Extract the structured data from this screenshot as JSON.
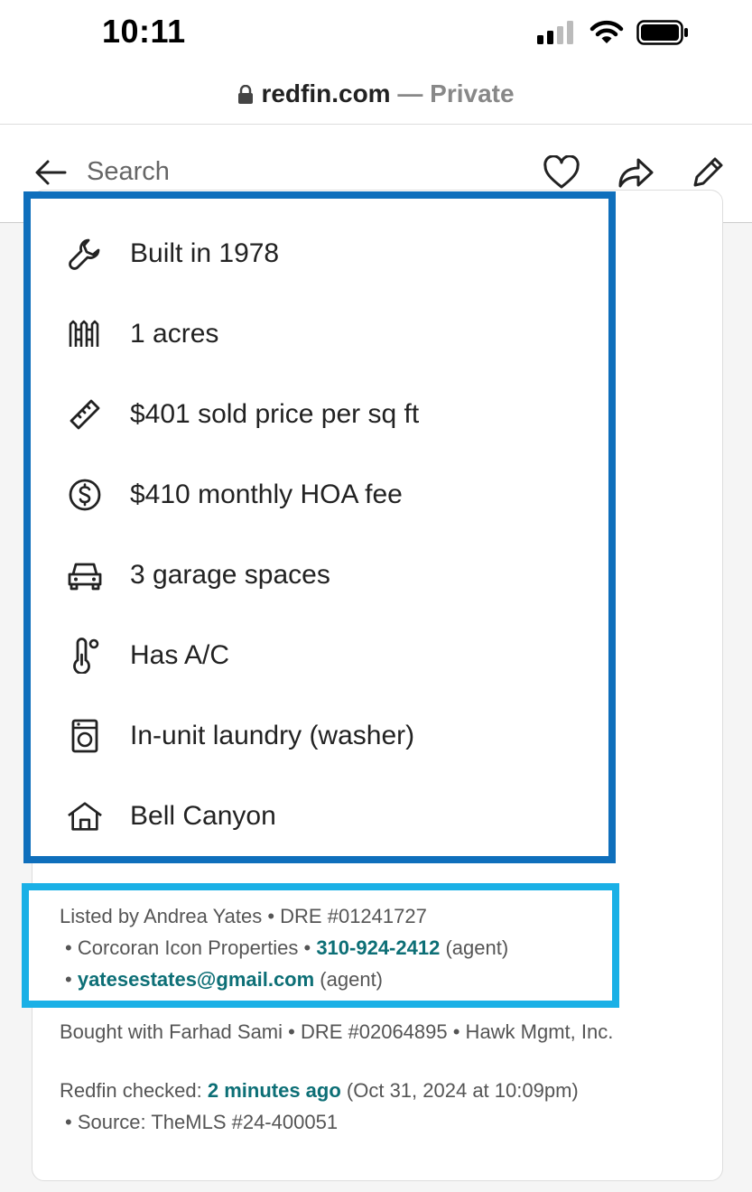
{
  "status": {
    "time": "10:11"
  },
  "browser": {
    "domain": "redfin.com",
    "separator": " — ",
    "mode": "Private"
  },
  "nav": {
    "search_placeholder": "Search"
  },
  "features": [
    {
      "icon": "wrench-icon",
      "text": "Built in 1978"
    },
    {
      "icon": "fence-icon",
      "text": "1 acres"
    },
    {
      "icon": "ruler-icon",
      "text": "$401 sold price per sq ft"
    },
    {
      "icon": "dollar-circle-icon",
      "text": "$410 monthly HOA fee"
    },
    {
      "icon": "car-icon",
      "text": "3 garage spaces"
    },
    {
      "icon": "thermometer-icon",
      "text": "Has A/C"
    },
    {
      "icon": "washer-icon",
      "text": "In-unit laundry (washer)"
    },
    {
      "icon": "house-icon",
      "text": "Bell Canyon"
    }
  ],
  "listing": {
    "listed_by": "Listed by Andrea Yates • DRE #01241727",
    "brokerage_prefix": "• Corcoran Icon Properties • ",
    "phone": "310-924-2412",
    "agent_suffix": " (agent)",
    "email_prefix": "• ",
    "email": "yatesestates@gmail.com",
    "bought_with": "Bought with Farhad Sami • DRE #02064895 •  Hawk Mgmt, Inc.",
    "checked_prefix": "Redfin checked: ",
    "checked_time": "2 minutes ago",
    "checked_suffix": " (Oct 31, 2024 at 10:09pm)",
    "source": "• Source:  TheMLS #24-400051"
  }
}
